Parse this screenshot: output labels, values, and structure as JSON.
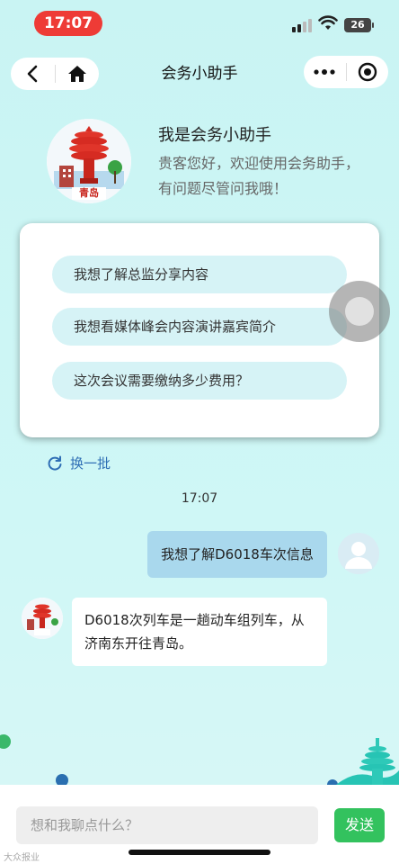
{
  "status_bar": {
    "time": "17:07",
    "battery": "26"
  },
  "nav": {
    "title": "会务小助手"
  },
  "intro": {
    "title": "我是会务小助手",
    "text": "贵客您好，欢迎使用会务助手，有问题尽管问我哦！",
    "avatar_caption": "青岛"
  },
  "suggestions": [
    "我想了解总监分享内容",
    "我想看媒体峰会内容演讲嘉宾简介",
    "这次会议需要缴纳多少费用？"
  ],
  "refresh_label": "换一批",
  "chat": {
    "time": "17:07",
    "messages": [
      {
        "from": "user",
        "text": "我想了解D6018车次信息"
      },
      {
        "from": "bot",
        "text": "D6018次列车是一趟动车组列车，从济南东开往青岛。"
      }
    ]
  },
  "input": {
    "placeholder": "想和我聊点什么？",
    "send_label": "发送"
  },
  "watermark": "大众报业",
  "colors": {
    "accent_red": "#ee3b36",
    "send_green": "#33c25e",
    "user_bubble": "#a9d8ed",
    "suggestion_bg": "#d6f3f6",
    "link_blue": "#2f6fb5"
  }
}
